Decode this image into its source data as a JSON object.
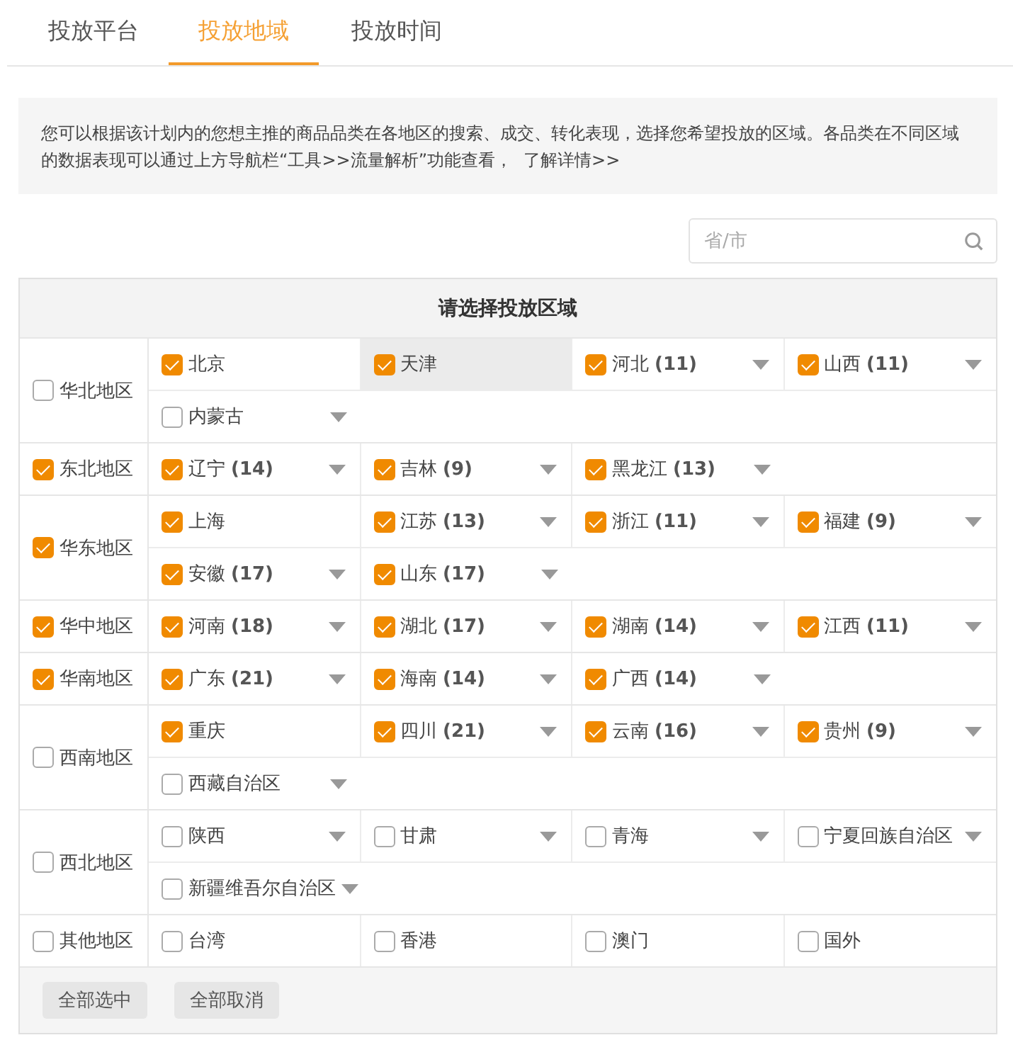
{
  "tabs": [
    {
      "label": "投放平台",
      "selected": false
    },
    {
      "label": "投放地域",
      "selected": true
    },
    {
      "label": "投放时间",
      "selected": false
    }
  ],
  "notice": {
    "text": "您可以根据该计划内的您想主推的商品品类在各地区的搜索、成交、转化表现，选择您希望投放的区域。各品类在不同区域的数据表现可以通过上方导航栏“工具>>流量解析”功能查看，",
    "link": "了解详情>>"
  },
  "search": {
    "placeholder": "省/市"
  },
  "table": {
    "title": "请选择投放区域",
    "regions": [
      {
        "name": "华北地区",
        "checked": false,
        "lines": [
          [
            {
              "name": "北京",
              "checked": true,
              "dropdown": false,
              "highlighted": false
            },
            {
              "name": "天津",
              "checked": true,
              "dropdown": false,
              "highlighted": true
            },
            {
              "name": "河北",
              "count": "(11)",
              "checked": true,
              "dropdown": true,
              "highlighted": false
            },
            {
              "name": "山西",
              "count": "(11)",
              "checked": true,
              "dropdown": true,
              "highlighted": false
            }
          ],
          [
            {
              "name": "内蒙古",
              "checked": false,
              "dropdown": true,
              "highlighted": false
            }
          ]
        ]
      },
      {
        "name": "东北地区",
        "checked": true,
        "lines": [
          [
            {
              "name": "辽宁",
              "count": "(14)",
              "checked": true,
              "dropdown": true,
              "highlighted": false
            },
            {
              "name": "吉林",
              "count": "(9)",
              "checked": true,
              "dropdown": true,
              "highlighted": false
            },
            {
              "name": "黑龙江",
              "count": "(13)",
              "checked": true,
              "dropdown": true,
              "highlighted": false
            }
          ]
        ]
      },
      {
        "name": "华东地区",
        "checked": true,
        "lines": [
          [
            {
              "name": "上海",
              "checked": true,
              "dropdown": false,
              "highlighted": false
            },
            {
              "name": "江苏",
              "count": "(13)",
              "checked": true,
              "dropdown": true,
              "highlighted": false
            },
            {
              "name": "浙江",
              "count": "(11)",
              "checked": true,
              "dropdown": true,
              "highlighted": false
            },
            {
              "name": "福建",
              "count": "(9)",
              "checked": true,
              "dropdown": true,
              "highlighted": false
            }
          ],
          [
            {
              "name": "安徽",
              "count": "(17)",
              "checked": true,
              "dropdown": true,
              "highlighted": false
            },
            {
              "name": "山东",
              "count": "(17)",
              "checked": true,
              "dropdown": true,
              "highlighted": false
            }
          ]
        ]
      },
      {
        "name": "华中地区",
        "checked": true,
        "lines": [
          [
            {
              "name": "河南",
              "count": "(18)",
              "checked": true,
              "dropdown": true,
              "highlighted": false
            },
            {
              "name": "湖北",
              "count": "(17)",
              "checked": true,
              "dropdown": true,
              "highlighted": false
            },
            {
              "name": "湖南",
              "count": "(14)",
              "checked": true,
              "dropdown": true,
              "highlighted": false
            },
            {
              "name": "江西",
              "count": "(11)",
              "checked": true,
              "dropdown": true,
              "highlighted": false
            }
          ]
        ]
      },
      {
        "name": "华南地区",
        "checked": true,
        "lines": [
          [
            {
              "name": "广东",
              "count": "(21)",
              "checked": true,
              "dropdown": true,
              "highlighted": false
            },
            {
              "name": "海南",
              "count": "(14)",
              "checked": true,
              "dropdown": true,
              "highlighted": false
            },
            {
              "name": "广西",
              "count": "(14)",
              "checked": true,
              "dropdown": true,
              "highlighted": false
            }
          ]
        ]
      },
      {
        "name": "西南地区",
        "checked": false,
        "lines": [
          [
            {
              "name": "重庆",
              "checked": true,
              "dropdown": false,
              "highlighted": false
            },
            {
              "name": "四川",
              "count": "(21)",
              "checked": true,
              "dropdown": true,
              "highlighted": false
            },
            {
              "name": "云南",
              "count": "(16)",
              "checked": true,
              "dropdown": true,
              "highlighted": false
            },
            {
              "name": "贵州",
              "count": "(9)",
              "checked": true,
              "dropdown": true,
              "highlighted": false
            }
          ],
          [
            {
              "name": "西藏自治区",
              "checked": false,
              "dropdown": true,
              "highlighted": false
            }
          ]
        ]
      },
      {
        "name": "西北地区",
        "checked": false,
        "lines": [
          [
            {
              "name": "陕西",
              "checked": false,
              "dropdown": true,
              "highlighted": false
            },
            {
              "name": "甘肃",
              "checked": false,
              "dropdown": true,
              "highlighted": false
            },
            {
              "name": "青海",
              "checked": false,
              "dropdown": true,
              "highlighted": false
            },
            {
              "name": "宁夏回族自治区",
              "checked": false,
              "dropdown": true,
              "highlighted": false
            }
          ],
          [
            {
              "name": "新疆维吾尔自治区",
              "checked": false,
              "dropdown": true,
              "highlighted": false
            }
          ]
        ]
      },
      {
        "name": "其他地区",
        "checked": false,
        "lines": [
          [
            {
              "name": "台湾",
              "checked": false,
              "dropdown": false,
              "highlighted": false
            },
            {
              "name": "香港",
              "checked": false,
              "dropdown": false,
              "highlighted": false
            },
            {
              "name": "澳门",
              "checked": false,
              "dropdown": false,
              "highlighted": false
            },
            {
              "name": "国外",
              "checked": false,
              "dropdown": false,
              "highlighted": false
            }
          ]
        ]
      }
    ]
  },
  "buttons": [
    "全部选中",
    "全部取消"
  ]
}
